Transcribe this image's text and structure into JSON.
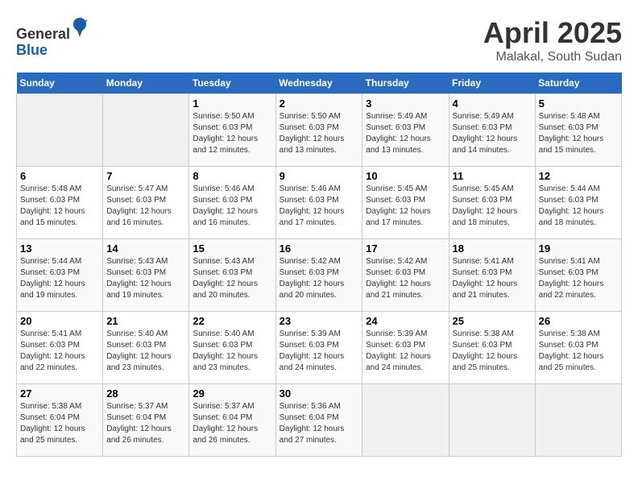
{
  "logo": {
    "general": "General",
    "blue": "Blue"
  },
  "title": "April 2025",
  "location": "Malakal, South Sudan",
  "days_of_week": [
    "Sunday",
    "Monday",
    "Tuesday",
    "Wednesday",
    "Thursday",
    "Friday",
    "Saturday"
  ],
  "weeks": [
    [
      {
        "day": "",
        "info": ""
      },
      {
        "day": "",
        "info": ""
      },
      {
        "day": "1",
        "info": "Sunrise: 5:50 AM\nSunset: 6:03 PM\nDaylight: 12 hours and 12 minutes."
      },
      {
        "day": "2",
        "info": "Sunrise: 5:50 AM\nSunset: 6:03 PM\nDaylight: 12 hours and 13 minutes."
      },
      {
        "day": "3",
        "info": "Sunrise: 5:49 AM\nSunset: 6:03 PM\nDaylight: 12 hours and 13 minutes."
      },
      {
        "day": "4",
        "info": "Sunrise: 5:49 AM\nSunset: 6:03 PM\nDaylight: 12 hours and 14 minutes."
      },
      {
        "day": "5",
        "info": "Sunrise: 5:48 AM\nSunset: 6:03 PM\nDaylight: 12 hours and 15 minutes."
      }
    ],
    [
      {
        "day": "6",
        "info": "Sunrise: 5:48 AM\nSunset: 6:03 PM\nDaylight: 12 hours and 15 minutes."
      },
      {
        "day": "7",
        "info": "Sunrise: 5:47 AM\nSunset: 6:03 PM\nDaylight: 12 hours and 16 minutes."
      },
      {
        "day": "8",
        "info": "Sunrise: 5:46 AM\nSunset: 6:03 PM\nDaylight: 12 hours and 16 minutes."
      },
      {
        "day": "9",
        "info": "Sunrise: 5:46 AM\nSunset: 6:03 PM\nDaylight: 12 hours and 17 minutes."
      },
      {
        "day": "10",
        "info": "Sunrise: 5:45 AM\nSunset: 6:03 PM\nDaylight: 12 hours and 17 minutes."
      },
      {
        "day": "11",
        "info": "Sunrise: 5:45 AM\nSunset: 6:03 PM\nDaylight: 12 hours and 18 minutes."
      },
      {
        "day": "12",
        "info": "Sunrise: 5:44 AM\nSunset: 6:03 PM\nDaylight: 12 hours and 18 minutes."
      }
    ],
    [
      {
        "day": "13",
        "info": "Sunrise: 5:44 AM\nSunset: 6:03 PM\nDaylight: 12 hours and 19 minutes."
      },
      {
        "day": "14",
        "info": "Sunrise: 5:43 AM\nSunset: 6:03 PM\nDaylight: 12 hours and 19 minutes."
      },
      {
        "day": "15",
        "info": "Sunrise: 5:43 AM\nSunset: 6:03 PM\nDaylight: 12 hours and 20 minutes."
      },
      {
        "day": "16",
        "info": "Sunrise: 5:42 AM\nSunset: 6:03 PM\nDaylight: 12 hours and 20 minutes."
      },
      {
        "day": "17",
        "info": "Sunrise: 5:42 AM\nSunset: 6:03 PM\nDaylight: 12 hours and 21 minutes."
      },
      {
        "day": "18",
        "info": "Sunrise: 5:41 AM\nSunset: 6:03 PM\nDaylight: 12 hours and 21 minutes."
      },
      {
        "day": "19",
        "info": "Sunrise: 5:41 AM\nSunset: 6:03 PM\nDaylight: 12 hours and 22 minutes."
      }
    ],
    [
      {
        "day": "20",
        "info": "Sunrise: 5:41 AM\nSunset: 6:03 PM\nDaylight: 12 hours and 22 minutes."
      },
      {
        "day": "21",
        "info": "Sunrise: 5:40 AM\nSunset: 6:03 PM\nDaylight: 12 hours and 23 minutes."
      },
      {
        "day": "22",
        "info": "Sunrise: 5:40 AM\nSunset: 6:03 PM\nDaylight: 12 hours and 23 minutes."
      },
      {
        "day": "23",
        "info": "Sunrise: 5:39 AM\nSunset: 6:03 PM\nDaylight: 12 hours and 24 minutes."
      },
      {
        "day": "24",
        "info": "Sunrise: 5:39 AM\nSunset: 6:03 PM\nDaylight: 12 hours and 24 minutes."
      },
      {
        "day": "25",
        "info": "Sunrise: 5:38 AM\nSunset: 6:03 PM\nDaylight: 12 hours and 25 minutes."
      },
      {
        "day": "26",
        "info": "Sunrise: 5:38 AM\nSunset: 6:03 PM\nDaylight: 12 hours and 25 minutes."
      }
    ],
    [
      {
        "day": "27",
        "info": "Sunrise: 5:38 AM\nSunset: 6:04 PM\nDaylight: 12 hours and 25 minutes."
      },
      {
        "day": "28",
        "info": "Sunrise: 5:37 AM\nSunset: 6:04 PM\nDaylight: 12 hours and 26 minutes."
      },
      {
        "day": "29",
        "info": "Sunrise: 5:37 AM\nSunset: 6:04 PM\nDaylight: 12 hours and 26 minutes."
      },
      {
        "day": "30",
        "info": "Sunrise: 5:36 AM\nSunset: 6:04 PM\nDaylight: 12 hours and 27 minutes."
      },
      {
        "day": "",
        "info": ""
      },
      {
        "day": "",
        "info": ""
      },
      {
        "day": "",
        "info": ""
      }
    ]
  ]
}
